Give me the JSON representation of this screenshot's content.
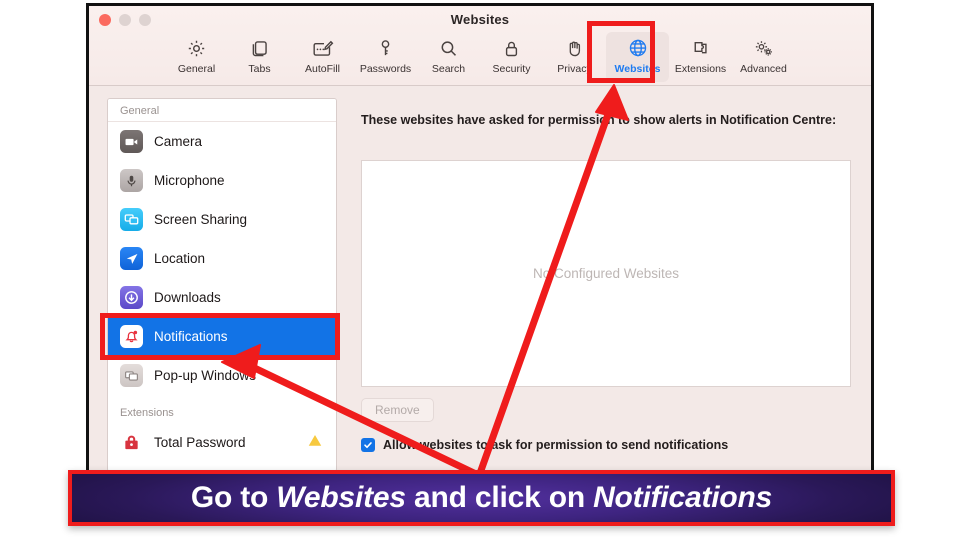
{
  "window": {
    "title": "Websites",
    "traffic_lights": [
      "close",
      "minimize",
      "zoom"
    ]
  },
  "toolbar": {
    "items": [
      {
        "label": "General",
        "icon": "gear-icon",
        "selected": false
      },
      {
        "label": "Tabs",
        "icon": "tabs-icon",
        "selected": false
      },
      {
        "label": "AutoFill",
        "icon": "autofill-icon",
        "selected": false
      },
      {
        "label": "Passwords",
        "icon": "key-icon",
        "selected": false
      },
      {
        "label": "Search",
        "icon": "magnifier-icon",
        "selected": false
      },
      {
        "label": "Security",
        "icon": "lock-icon",
        "selected": false
      },
      {
        "label": "Privacy",
        "icon": "hand-icon",
        "selected": false
      },
      {
        "label": "Websites",
        "icon": "globe-icon",
        "selected": true
      },
      {
        "label": "Extensions",
        "icon": "puzzle-icon",
        "selected": false
      },
      {
        "label": "Advanced",
        "icon": "gears-icon",
        "selected": false
      }
    ],
    "selected_accent": "#1f7bf0"
  },
  "sidebar": {
    "sections": [
      {
        "header": "General",
        "items": [
          {
            "label": "Camera",
            "icon": "camera-icon",
            "color": "#6e6766",
            "active": false,
            "warning": false
          },
          {
            "label": "Microphone",
            "icon": "microphone-icon",
            "color": "#b8b2b1",
            "active": false,
            "warning": false
          },
          {
            "label": "Screen Sharing",
            "icon": "screen-sharing-icon",
            "color": "#2ec0f5",
            "active": false,
            "warning": false
          },
          {
            "label": "Location",
            "icon": "location-icon",
            "color": "#1273e6",
            "active": false,
            "warning": false
          },
          {
            "label": "Downloads",
            "icon": "downloads-icon",
            "color": "#6d5cd6",
            "active": false,
            "warning": false
          },
          {
            "label": "Notifications",
            "icon": "bell-icon",
            "color": "#ffffff",
            "active": true,
            "warning": false
          },
          {
            "label": "Pop-up Windows",
            "icon": "popup-windows-icon",
            "color": "#d6cfcd",
            "active": false,
            "warning": false
          }
        ]
      },
      {
        "header": "Extensions",
        "items": [
          {
            "label": "Total Password",
            "icon": "padlock-icon",
            "color": "#d83a45",
            "active": false,
            "warning": true
          }
        ]
      }
    ],
    "active_background": "#1273e6"
  },
  "pane": {
    "description": "These websites have asked for permission to show alerts in Notification Centre:",
    "empty_state": "No Configured Websites",
    "remove_label": "Remove",
    "allow_checkbox": {
      "label": "Allow websites to ask for permission to send notifications",
      "checked": true,
      "color": "#1273e6"
    }
  },
  "annotations": {
    "highlight_color": "#ef1c1c",
    "highlight_targets": [
      "websites-toolbar-tab",
      "notifications-sidebar-item"
    ],
    "arrows": [
      {
        "from": "caption-banner",
        "to": "websites-toolbar-tab"
      },
      {
        "from": "caption-banner",
        "to": "notifications-sidebar-item"
      }
    ],
    "caption": {
      "prefix": "Go to ",
      "emphasis_one": "Websites",
      "middle": " and click on ",
      "emphasis_two": "Notifications",
      "text_color": "#ffffff",
      "border_color": "#ef1c1c"
    }
  }
}
